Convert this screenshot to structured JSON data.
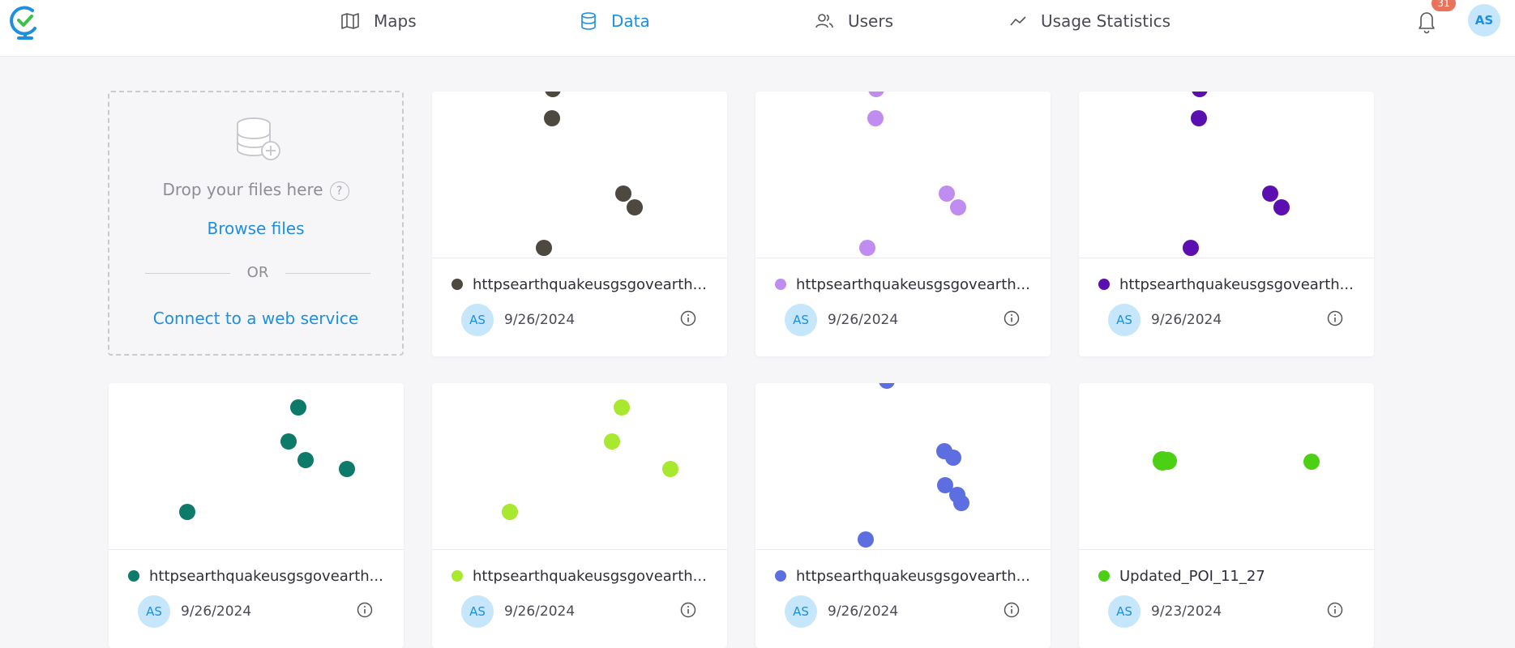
{
  "nav": {
    "maps": "Maps",
    "data": "Data",
    "users": "Users",
    "usage": "Usage Statistics"
  },
  "notifications": {
    "count": "31"
  },
  "user": {
    "initials": "AS"
  },
  "upload": {
    "drop_text": "Drop your files here",
    "help": "?",
    "browse": "Browse files",
    "or": "OR",
    "connect": "Connect to a web service"
  },
  "colors": {
    "accent": "#1e8fe0",
    "badge": "#e8735a"
  },
  "datasets": [
    {
      "name": "httpsearthquakeusgsgovearth...",
      "date": "9/26/2024",
      "owner": "AS",
      "color": "#4d4840"
    },
    {
      "name": "httpsearthquakeusgsgovearth...",
      "date": "9/26/2024",
      "owner": "AS",
      "color": "#c08cf0"
    },
    {
      "name": "httpsearthquakeusgsgovearth...",
      "date": "9/26/2024",
      "owner": "AS",
      "color": "#5c0fb0"
    },
    {
      "name": "httpsearthquakeusgsgovearth...",
      "date": "9/26/2024",
      "owner": "AS",
      "color": "#0d7a6a"
    },
    {
      "name": "httpsearthquakeusgsgovearth...",
      "date": "9/26/2024",
      "owner": "AS",
      "color": "#a8e82e"
    },
    {
      "name": "httpsearthquakeusgsgovearth...",
      "date": "9/26/2024",
      "owner": "AS",
      "color": "#5c6ee0"
    },
    {
      "name": "Updated_POI_11_27",
      "date": "9/23/2024",
      "owner": "AS",
      "color": "#4cd014"
    }
  ]
}
